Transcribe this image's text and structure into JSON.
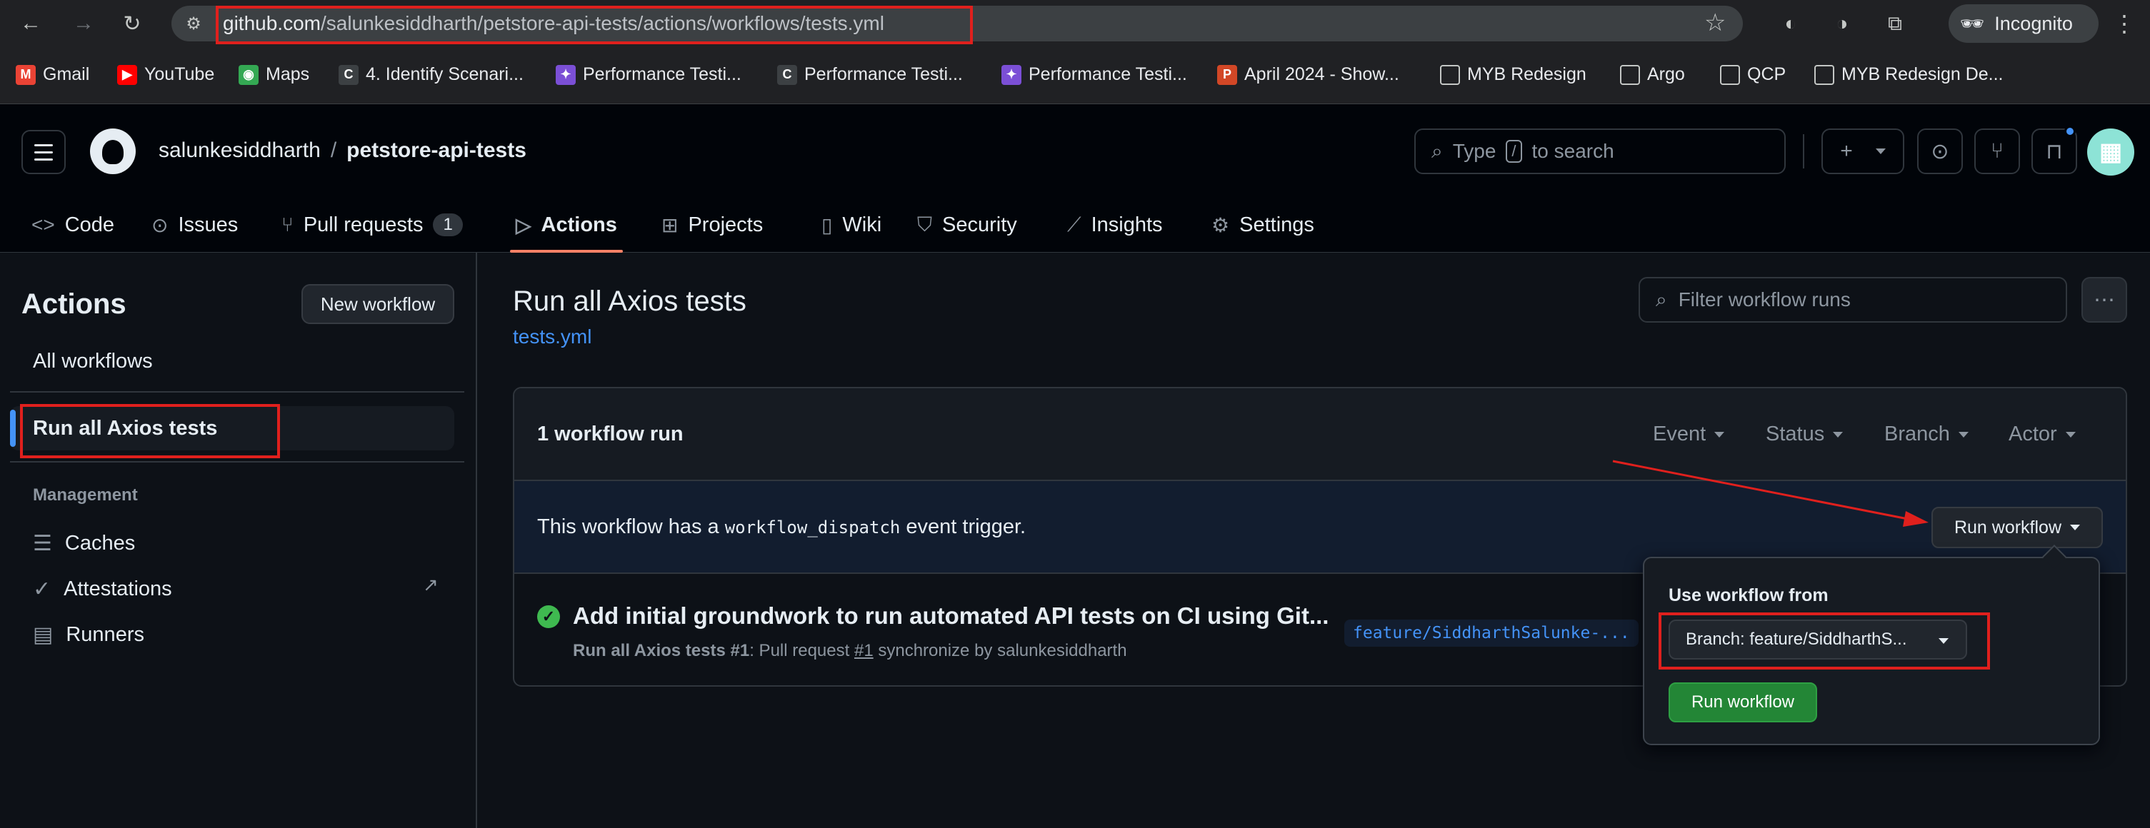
{
  "browser": {
    "url_host": "github.com",
    "url_path": "/salunkesiddharth/petstore-api-tests/actions/workflows/tests.yml",
    "incognito_label": "Incognito",
    "bookmarks": [
      {
        "label": "Gmail",
        "icon": "gmail-icon",
        "color": "#ea4335",
        "glyph": "M"
      },
      {
        "label": "YouTube",
        "icon": "youtube-icon",
        "color": "#ff0000",
        "glyph": "▶"
      },
      {
        "label": "Maps",
        "icon": "maps-icon",
        "color": "#34a853",
        "glyph": "◉"
      },
      {
        "label": "4. Identify Scenari...",
        "icon": "coursera-icon",
        "color": "#3c4043",
        "glyph": "C"
      },
      {
        "label": "Performance Testi...",
        "icon": "app-icon",
        "color": "#7b4fd6",
        "glyph": "✦"
      },
      {
        "label": "Performance Testi...",
        "icon": "coursera-icon",
        "color": "#3c4043",
        "glyph": "C"
      },
      {
        "label": "Performance Testi...",
        "icon": "app-icon",
        "color": "#7b4fd6",
        "glyph": "✦"
      },
      {
        "label": "April 2024 - Show...",
        "icon": "powerpoint-icon",
        "color": "#d24726",
        "glyph": "P"
      },
      {
        "label": "MYB Redesign",
        "icon": "folder-icon",
        "color": "transparent",
        "glyph": "▭"
      },
      {
        "label": "Argo",
        "icon": "folder-icon",
        "color": "transparent",
        "glyph": "▭"
      },
      {
        "label": "QCP",
        "icon": "folder-icon",
        "color": "transparent",
        "glyph": "▭"
      },
      {
        "label": "MYB Redesign De...",
        "icon": "folder-icon",
        "color": "transparent",
        "glyph": "▭"
      }
    ]
  },
  "header": {
    "owner": "salunkesiddharth",
    "separator": "/",
    "repo": "petstore-api-tests",
    "search_pre": "Type",
    "search_key": "/",
    "search_post": "to search"
  },
  "tabs": [
    {
      "label": "Code",
      "icon": "code-icon",
      "glyph": "<>"
    },
    {
      "label": "Issues",
      "icon": "issue-icon",
      "glyph": "⊙"
    },
    {
      "label": "Pull requests",
      "icon": "pull-request-icon",
      "glyph": "⑂",
      "count": "1"
    },
    {
      "label": "Actions",
      "icon": "play-icon",
      "glyph": "▷"
    },
    {
      "label": "Projects",
      "icon": "table-icon",
      "glyph": "⊞"
    },
    {
      "label": "Wiki",
      "icon": "book-icon",
      "glyph": "▯"
    },
    {
      "label": "Security",
      "icon": "shield-icon",
      "glyph": "⛉"
    },
    {
      "label": "Insights",
      "icon": "graph-icon",
      "glyph": "⟋"
    },
    {
      "label": "Settings",
      "icon": "gear-icon",
      "glyph": "⚙"
    }
  ],
  "sidebar": {
    "title": "Actions",
    "new_workflow": "New workflow",
    "all_workflows": "All workflows",
    "active_workflow": "Run all Axios tests",
    "section": "Management",
    "items": [
      {
        "label": "Caches",
        "icon": "database-icon",
        "glyph": "☰"
      },
      {
        "label": "Attestations",
        "icon": "verified-icon",
        "glyph": "✓"
      },
      {
        "label": "Runners",
        "icon": "server-icon",
        "glyph": "▤"
      }
    ],
    "external_glyph": "↗"
  },
  "main": {
    "title": "Run all Axios tests",
    "file": "tests.yml",
    "filter_placeholder": "Filter workflow runs",
    "run_count": "1 workflow run",
    "filters": [
      "Event",
      "Status",
      "Branch",
      "Actor"
    ],
    "dispatch_pre": "This workflow has a",
    "dispatch_code": "workflow_dispatch",
    "dispatch_post": "event trigger.",
    "run_workflow_dd": "Run workflow",
    "run": {
      "title": "Add initial groundwork to run automated API tests on CI using Git...",
      "workflow": "Run all Axios tests",
      "number": "#1",
      "meta_mid": ": Pull request",
      "pr": "#1",
      "meta_post": "synchronize by salunkesiddharth",
      "branch": "feature/SiddharthSalunke-..."
    }
  },
  "popover": {
    "label": "Use workflow from",
    "branch": "Branch: feature/SiddharthS...",
    "run_button": "Run workflow"
  },
  "colors": {
    "accent": "#4493f8",
    "success": "#3fb950",
    "primary_button": "#238636",
    "annotation": "#e0201d",
    "tab_underline": "#f78166"
  }
}
